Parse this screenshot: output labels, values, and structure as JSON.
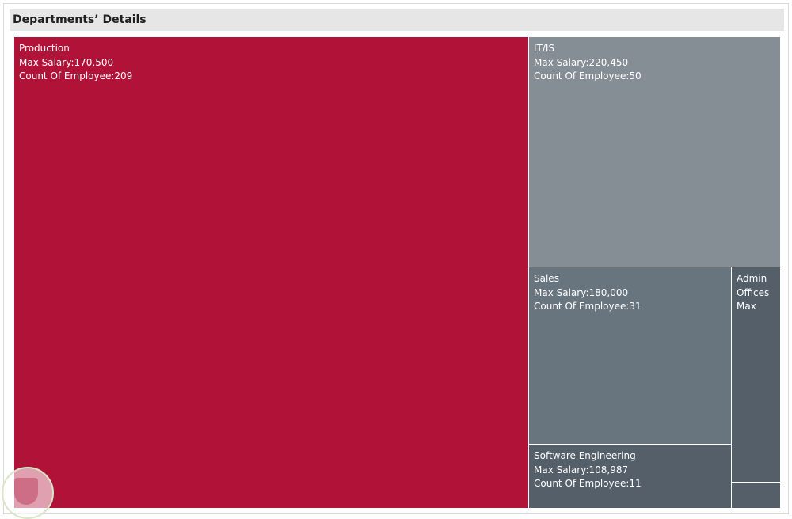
{
  "title": "Departments’ Details",
  "chart_data": {
    "type": "treemap",
    "title": "Departments’ Details",
    "size_measure": "Count Of Employee",
    "color_measure": "Max Salary",
    "items": [
      {
        "department": "Production",
        "max_salary_label": "Max Salary:170,500",
        "count_label": "Count Of Employee:209",
        "max_salary": 170500,
        "count": 209,
        "color": "#b01238"
      },
      {
        "department": "IT/IS",
        "max_salary_label": "Max Salary:220,450",
        "count_label": "Count Of Employee:50",
        "max_salary": 220450,
        "count": 50,
        "color": "#868e95"
      },
      {
        "department": "Sales",
        "max_salary_label": "Max Salary:180,000",
        "count_label": "Count Of Employee:31",
        "max_salary": 180000,
        "count": 31,
        "color": "#69757e"
      },
      {
        "department": "Software Engineering",
        "max_salary_label": "Max Salary:108,987",
        "count_label": "Count Of Employee:11",
        "max_salary": 108987,
        "count": 11,
        "color": "#555f69"
      },
      {
        "department": "Admin Offices",
        "max_salary_label": "Max",
        "count_label": "",
        "max_salary": null,
        "count": 9,
        "color": "#555f69"
      },
      {
        "department": "",
        "max_salary_label": "",
        "count_label": "",
        "max_salary": null,
        "count": 1,
        "color": "#555f69"
      }
    ]
  }
}
